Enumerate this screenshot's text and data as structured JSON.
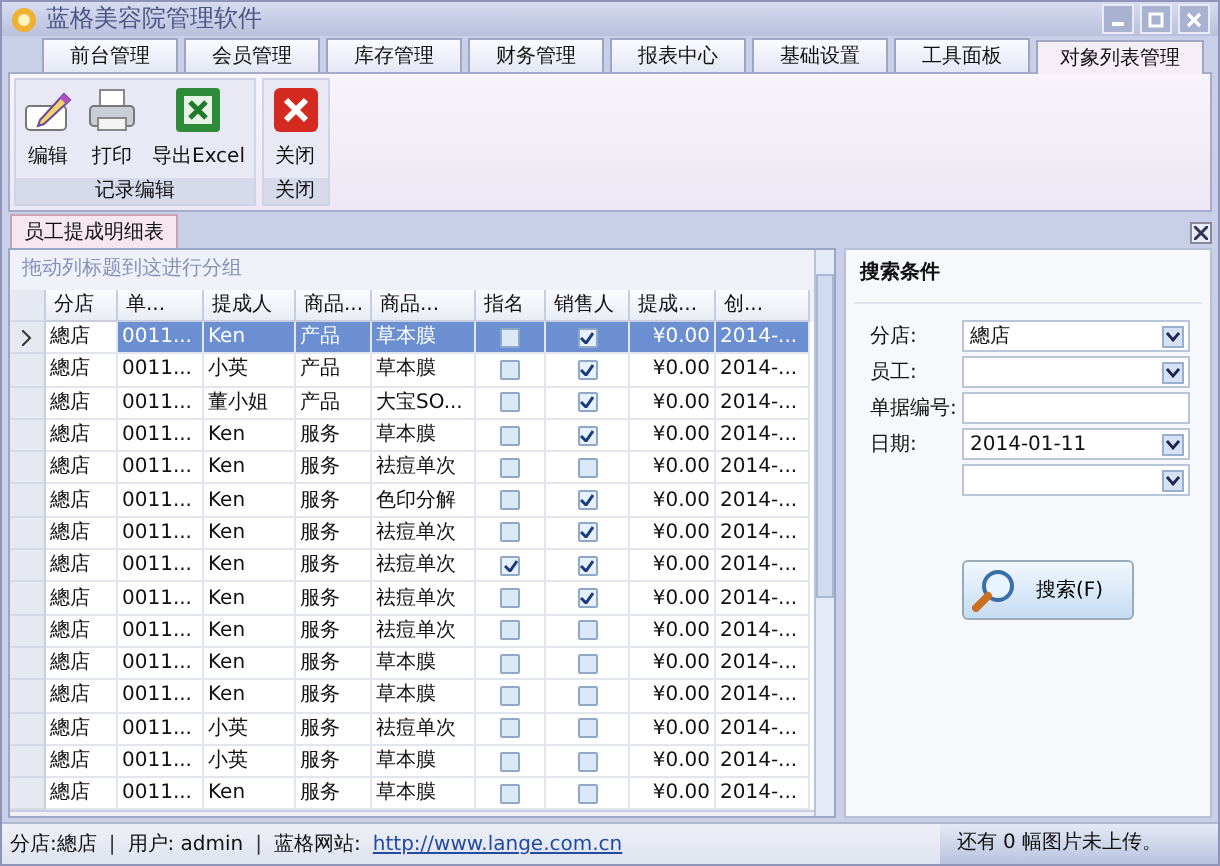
{
  "window": {
    "title": "蓝格美容院管理软件"
  },
  "tabs": [
    {
      "label": "前台管理",
      "selected": false
    },
    {
      "label": "会员管理",
      "selected": false
    },
    {
      "label": "库存管理",
      "selected": false
    },
    {
      "label": "财务管理",
      "selected": false
    },
    {
      "label": "报表中心",
      "selected": false
    },
    {
      "label": "基础设置",
      "selected": false
    },
    {
      "label": "工具面板",
      "selected": false
    },
    {
      "label": "对象列表管理",
      "selected": true
    }
  ],
  "ribbon_groups": [
    {
      "label": "记录编辑",
      "buttons": [
        {
          "label": "编辑",
          "kind": "edit"
        },
        {
          "label": "打印",
          "kind": "print"
        },
        {
          "label": "导出Excel",
          "kind": "excel"
        }
      ]
    },
    {
      "label": "关闭",
      "buttons": [
        {
          "label": "关闭",
          "kind": "close"
        }
      ]
    }
  ],
  "document_tab": "员工提成明细表",
  "group_hint": "拖动列标题到这进行分组",
  "table": {
    "columns": [
      "分店",
      "单...",
      "提成人",
      "商品...",
      "商品...",
      "指名",
      "销售人",
      "提成...",
      "创..."
    ],
    "rows": [
      {
        "shop": "總店",
        "no": "0011...",
        "person": "Ken",
        "type": "产品",
        "item": "草本膜",
        "named": false,
        "sales": true,
        "amount": "¥0.00",
        "created": "2014-...",
        "selected": true
      },
      {
        "shop": "總店",
        "no": "0011...",
        "person": "小英",
        "type": "产品",
        "item": "草本膜",
        "named": false,
        "sales": true,
        "amount": "¥0.00",
        "created": "2014-...",
        "selected": false
      },
      {
        "shop": "總店",
        "no": "0011...",
        "person": "董小姐",
        "type": "产品",
        "item": "大宝SO...",
        "named": false,
        "sales": true,
        "amount": "¥0.00",
        "created": "2014-...",
        "selected": false
      },
      {
        "shop": "總店",
        "no": "0011...",
        "person": "Ken",
        "type": "服务",
        "item": "草本膜",
        "named": false,
        "sales": true,
        "amount": "¥0.00",
        "created": "2014-...",
        "selected": false
      },
      {
        "shop": "總店",
        "no": "0011...",
        "person": "Ken",
        "type": "服务",
        "item": "祛痘单次",
        "named": false,
        "sales": false,
        "amount": "¥0.00",
        "created": "2014-...",
        "selected": false
      },
      {
        "shop": "總店",
        "no": "0011...",
        "person": "Ken",
        "type": "服务",
        "item": "色印分解",
        "named": false,
        "sales": true,
        "amount": "¥0.00",
        "created": "2014-...",
        "selected": false
      },
      {
        "shop": "總店",
        "no": "0011...",
        "person": "Ken",
        "type": "服务",
        "item": "祛痘单次",
        "named": false,
        "sales": true,
        "amount": "¥0.00",
        "created": "2014-...",
        "selected": false
      },
      {
        "shop": "總店",
        "no": "0011...",
        "person": "Ken",
        "type": "服务",
        "item": "祛痘单次",
        "named": true,
        "sales": true,
        "amount": "¥0.00",
        "created": "2014-...",
        "selected": false
      },
      {
        "shop": "總店",
        "no": "0011...",
        "person": "Ken",
        "type": "服务",
        "item": "祛痘单次",
        "named": false,
        "sales": true,
        "amount": "¥0.00",
        "created": "2014-...",
        "selected": false
      },
      {
        "shop": "總店",
        "no": "0011...",
        "person": "Ken",
        "type": "服务",
        "item": "祛痘单次",
        "named": false,
        "sales": false,
        "amount": "¥0.00",
        "created": "2014-...",
        "selected": false
      },
      {
        "shop": "總店",
        "no": "0011...",
        "person": "Ken",
        "type": "服务",
        "item": "草本膜",
        "named": false,
        "sales": false,
        "amount": "¥0.00",
        "created": "2014-...",
        "selected": false
      },
      {
        "shop": "總店",
        "no": "0011...",
        "person": "Ken",
        "type": "服务",
        "item": "草本膜",
        "named": false,
        "sales": false,
        "amount": "¥0.00",
        "created": "2014-...",
        "selected": false
      },
      {
        "shop": "總店",
        "no": "0011...",
        "person": "小英",
        "type": "服务",
        "item": "祛痘单次",
        "named": false,
        "sales": false,
        "amount": "¥0.00",
        "created": "2014-...",
        "selected": false
      },
      {
        "shop": "總店",
        "no": "0011...",
        "person": "小英",
        "type": "服务",
        "item": "草本膜",
        "named": false,
        "sales": false,
        "amount": "¥0.00",
        "created": "2014-...",
        "selected": false
      },
      {
        "shop": "總店",
        "no": "0011...",
        "person": "Ken",
        "type": "服务",
        "item": "草本膜",
        "named": false,
        "sales": false,
        "amount": "¥0.00",
        "created": "2014-...",
        "selected": false
      }
    ]
  },
  "search_panel": {
    "title": "搜索条件",
    "fields": [
      {
        "label": "分店:",
        "value": "總店",
        "kind": "dropdown"
      },
      {
        "label": "员工:",
        "kind": "dropdown"
      },
      {
        "label": "单据编号:",
        "kind": "text"
      },
      {
        "label": "日期:",
        "value": "2014-01-11",
        "kind": "dropdown"
      },
      {
        "kind": "dropdown"
      }
    ],
    "button": "搜索(F)"
  },
  "status_bar": {
    "separator": "|",
    "shop_label": "分店:",
    "shop": "總店",
    "user_label": "用户:",
    "user": "admin",
    "site_label": "蓝格网站:",
    "site": "http://www.lange.com.cn",
    "upload": "还有 0 幅图片未上传。"
  }
}
